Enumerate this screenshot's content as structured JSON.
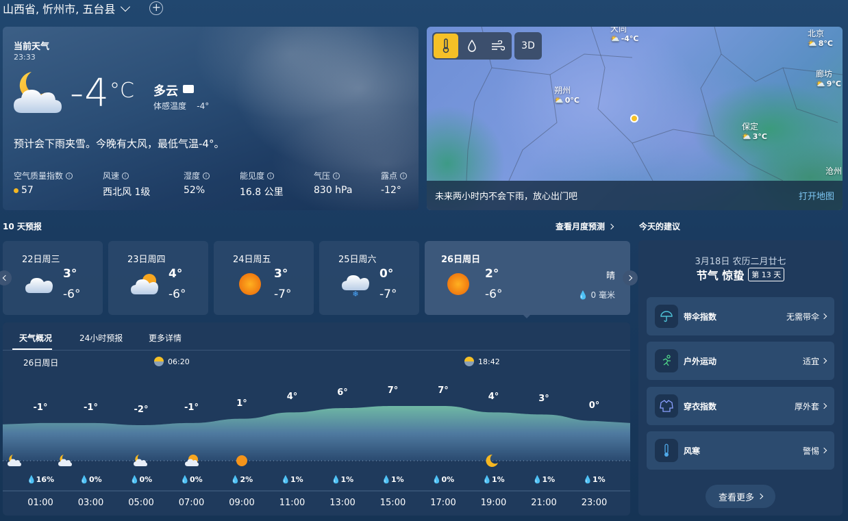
{
  "topbar": {
    "location": "山西省, 忻州市, 五台县"
  },
  "current": {
    "label": "当前天气",
    "time": "23:33",
    "temp": "-4",
    "unit": "°C",
    "condition": "多云",
    "feels_label": "体感温度",
    "feels_value": "-4°",
    "summary": "预计会下雨夹雪。今晚有大风，最低气温-4°。",
    "stats": [
      {
        "label": "空气质量指数",
        "value": "57"
      },
      {
        "label": "风速",
        "value": "西北风 1级"
      },
      {
        "label": "湿度",
        "value": "52%"
      },
      {
        "label": "能见度",
        "value": "16.8 公里"
      },
      {
        "label": "气压",
        "value": "830 hPa"
      },
      {
        "label": "露点",
        "value": "-12°"
      }
    ]
  },
  "map": {
    "mode_3d": "3D",
    "cities": [
      {
        "name": "大同",
        "temp": "-4°C"
      },
      {
        "name": "北京",
        "temp": "8°C"
      },
      {
        "name": "廊坊",
        "temp": "9°C"
      },
      {
        "name": "朔州",
        "temp": "0°C"
      },
      {
        "name": "保定",
        "temp": "3°C"
      },
      {
        "name": "沧州",
        "temp": ""
      }
    ],
    "footer_text": "未来两小时内不会下雨，放心出门吧",
    "open_link": "打开地图"
  },
  "forecast": {
    "title": "10 天预报",
    "monthly_link": "查看月度预测",
    "days": [
      {
        "name": "22日周三",
        "hi": "3°",
        "lo": "-6°",
        "icon": "cloudy-icon"
      },
      {
        "name": "23日周四",
        "hi": "4°",
        "lo": "-6°",
        "icon": "partly-sunny-icon"
      },
      {
        "name": "24日周五",
        "hi": "3°",
        "lo": "-7°",
        "icon": "sunny-icon"
      },
      {
        "name": "25日周六",
        "hi": "0°",
        "lo": "-7°",
        "icon": "snow-icon"
      },
      {
        "name": "26日周日",
        "hi": "2°",
        "lo": "-6°",
        "icon": "sunny-icon",
        "condition": "晴",
        "rain": "0 毫米"
      }
    ]
  },
  "hourly": {
    "tabs": [
      "天气概况",
      "24小时预报",
      "更多详情"
    ],
    "date": "26日周日",
    "sunrise": "06:20",
    "sunset": "18:42",
    "hours": [
      {
        "time": "01:00",
        "temp": "-1°",
        "t": -1,
        "rain": "16%",
        "icon": "cloudy-night"
      },
      {
        "time": "03:00",
        "temp": "-1°",
        "t": -1,
        "rain": "0%",
        "icon": "cloudy-night"
      },
      {
        "time": "05:00",
        "temp": "-2°",
        "t": -2,
        "rain": "0%",
        "icon": "cloudy-night"
      },
      {
        "time": "07:00",
        "temp": "-1°",
        "t": -1,
        "rain": "0%",
        "icon": "partly-sunny"
      },
      {
        "time": "09:00",
        "temp": "1°",
        "t": 1,
        "rain": "2%",
        "icon": "sunny"
      },
      {
        "time": "11:00",
        "temp": "4°",
        "t": 4,
        "rain": "1%",
        "icon": ""
      },
      {
        "time": "13:00",
        "temp": "6°",
        "t": 6,
        "rain": "1%",
        "icon": ""
      },
      {
        "time": "15:00",
        "temp": "7°",
        "t": 7,
        "rain": "1%",
        "icon": ""
      },
      {
        "time": "17:00",
        "temp": "7°",
        "t": 7,
        "rain": "0%",
        "icon": ""
      },
      {
        "time": "19:00",
        "temp": "4°",
        "t": 4,
        "rain": "1%",
        "icon": "moon"
      },
      {
        "time": "21:00",
        "temp": "3°",
        "t": 3,
        "rain": "1%",
        "icon": ""
      },
      {
        "time": "23:00",
        "temp": "0°",
        "t": 0,
        "rain": "1%",
        "icon": ""
      }
    ]
  },
  "advice": {
    "title": "今天的建议",
    "date": "3月18日 农历二月廿七",
    "solar_term": "节气 惊蛰",
    "solar_day": "第 13 天",
    "items": [
      {
        "name": "带伞指数",
        "value": "无需带伞",
        "icon": "umbrella-icon"
      },
      {
        "name": "户外运动",
        "value": "适宜",
        "icon": "running-icon"
      },
      {
        "name": "穿衣指数",
        "value": "厚外套",
        "icon": "coat-icon"
      },
      {
        "name": "风寒",
        "value": "警惕",
        "icon": "thermometer-icon"
      }
    ],
    "more": "查看更多"
  },
  "colors": {
    "accent": "#f5c027",
    "link": "#7ec6f3",
    "graph_fill": "#5d9a96"
  }
}
